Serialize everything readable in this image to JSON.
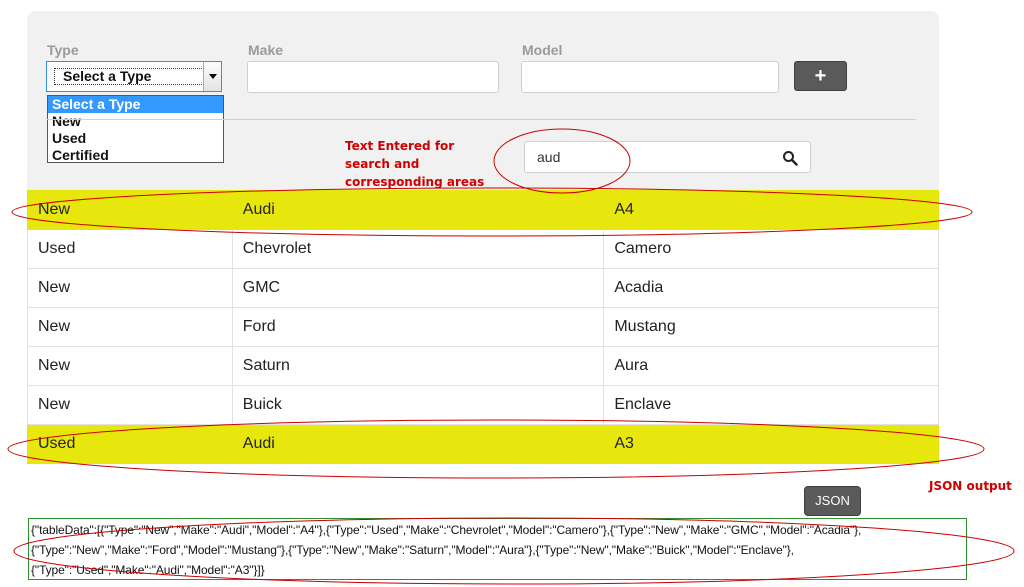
{
  "form": {
    "type_label": "Type",
    "make_label": "Make",
    "model_label": "Model",
    "type_selected": "Select a Type",
    "type_options": [
      "Select a Type",
      "New",
      "Used",
      "Certified"
    ],
    "make_value": "",
    "model_value": "",
    "add_label": "+"
  },
  "search": {
    "value": "aud",
    "icon": "search-icon"
  },
  "annotations": {
    "search_note": "Text Entered for search and corresponding areas highlighted",
    "json_note": "JSON output"
  },
  "table": {
    "rows": [
      {
        "type": "New",
        "make": "Audi",
        "model": "A4",
        "highlighted": true
      },
      {
        "type": "Used",
        "make": "Chevrolet",
        "model": "Camero",
        "highlighted": false
      },
      {
        "type": "New",
        "make": "GMC",
        "model": "Acadia",
        "highlighted": false
      },
      {
        "type": "New",
        "make": "Ford",
        "model": "Mustang",
        "highlighted": false
      },
      {
        "type": "New",
        "make": "Saturn",
        "model": "Aura",
        "highlighted": false
      },
      {
        "type": "New",
        "make": "Buick",
        "model": "Enclave",
        "highlighted": false
      },
      {
        "type": "Used",
        "make": "Audi",
        "model": "A3",
        "highlighted": true
      }
    ]
  },
  "json_button": "JSON",
  "json_output": "{\"tableData\":[{\"Type\":\"New\",\"Make\":\"Audi\",\"Model\":\"A4\"},{\"Type\":\"Used\",\"Make\":\"Chevrolet\",\"Model\":\"Camero\"},{\"Type\":\"New\",\"Make\":\"GMC\",\"Model\":\"Acadia\"},{\"Type\":\"New\",\"Make\":\"Ford\",\"Model\":\"Mustang\"},{\"Type\":\"New\",\"Make\":\"Saturn\",\"Model\":\"Aura\"},{\"Type\":\"New\",\"Make\":\"Buick\",\"Model\":\"Enclave\"},{\"Type\":\"Used\",\"Make\":\"Audi\",\"Model\":\"A3\"}]}",
  "colors": {
    "highlight": "#e7e70e",
    "annotation": "#d00000",
    "button": "#5a5a5a",
    "json_border": "#2f8f2f"
  }
}
